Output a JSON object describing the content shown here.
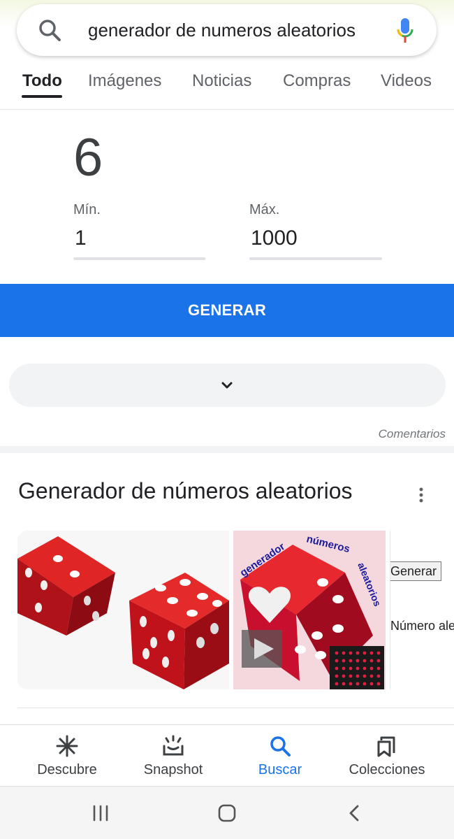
{
  "search": {
    "query": "generador de numeros aleatorios"
  },
  "tabs": [
    {
      "label": "Todo",
      "active": true
    },
    {
      "label": "Imágenes"
    },
    {
      "label": "Noticias"
    },
    {
      "label": "Compras"
    },
    {
      "label": "Videos"
    }
  ],
  "generator": {
    "result": "6",
    "min_label": "Mín.",
    "min_value": "1",
    "max_label": "Máx.",
    "max_value": "1000",
    "button_label": "GENERAR"
  },
  "feedback_label": "Comentarios",
  "images": {
    "title": "Generador de números aleatorios",
    "thumb2_words": [
      "generador",
      "números",
      "aleatorios"
    ],
    "thumb3_button": "Generar",
    "thumb3_text": "Número alea"
  },
  "bottom_nav": [
    {
      "label": "Descubre",
      "icon": "asterisk-icon"
    },
    {
      "label": "Snapshot",
      "icon": "snapshot-icon"
    },
    {
      "label": "Buscar",
      "icon": "search-icon",
      "active": true
    },
    {
      "label": "Colecciones",
      "icon": "collections-icon"
    }
  ],
  "colors": {
    "accent": "#1a73e8",
    "dice_red": "#c8102e"
  }
}
